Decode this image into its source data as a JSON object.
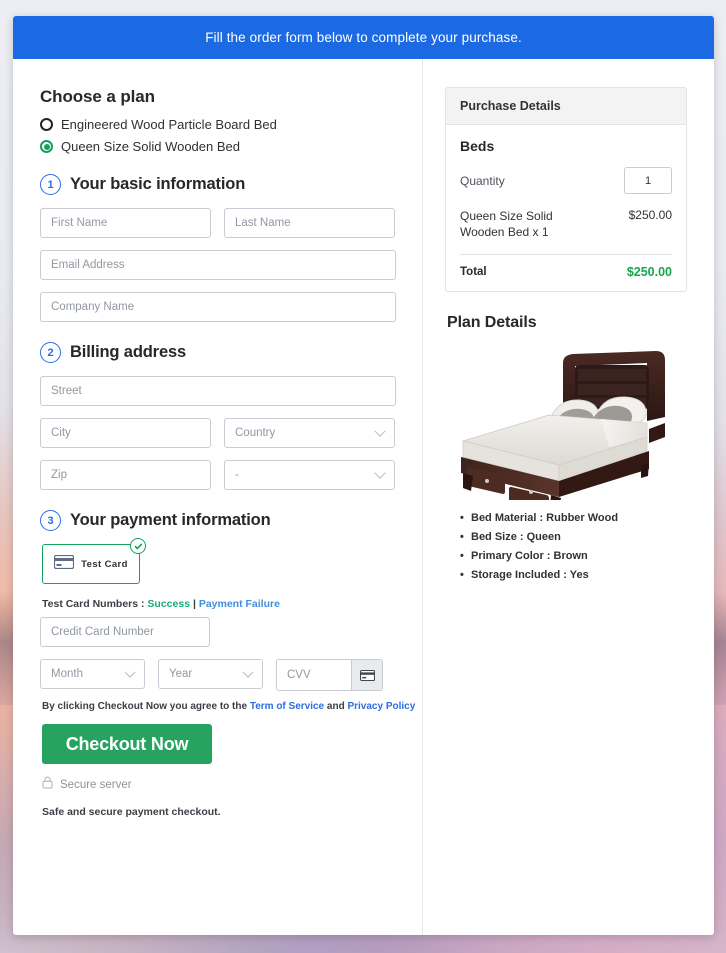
{
  "banner": {
    "text": "Fill the order form below to complete your purchase."
  },
  "plan": {
    "heading": "Choose a plan",
    "options": [
      {
        "label": "Engineered Wood Particle Board Bed",
        "selected": false
      },
      {
        "label": "Queen Size Solid Wooden Bed",
        "selected": true
      }
    ]
  },
  "step1": {
    "number": "1",
    "title": "Your basic information",
    "first_name_placeholder": "First Name",
    "last_name_placeholder": "Last Name",
    "email_placeholder": "Email Address",
    "company_placeholder": "Company Name"
  },
  "step2": {
    "number": "2",
    "title": "Billing address",
    "street_placeholder": "Street",
    "city_placeholder": "City",
    "country_placeholder": "Country",
    "zip_placeholder": "Zip",
    "state_placeholder": "-"
  },
  "step3": {
    "number": "3",
    "title": "Your payment information",
    "test_card_label": "Test  Card",
    "test_numbers_prefix": "Test Card Numbers : ",
    "test_numbers_success": "Success",
    "test_numbers_separator": " | ",
    "test_numbers_failure": "Payment Failure",
    "card_number_placeholder": "Credit Card Number",
    "month_placeholder": "Month",
    "year_placeholder": "Year",
    "cvv_placeholder": "CVV"
  },
  "footer": {
    "terms_prefix": "By clicking Checkout Now you agree to the ",
    "terms_link": "Term of Service",
    "terms_and": " and ",
    "privacy_link": "Privacy Policy",
    "checkout_label": "Checkout Now",
    "secure_server": "Secure server",
    "safe_note": "Safe and secure payment checkout."
  },
  "purchase": {
    "header": "Purchase Details",
    "category": "Beds",
    "quantity_label": "Quantity",
    "quantity_value": "1",
    "item_name": "Queen Size Solid Wooden Bed x 1",
    "item_price": "$250.00",
    "total_label": "Total",
    "total_value": "$250.00"
  },
  "plan_details": {
    "title": "Plan Details",
    "image_alt": "queen-size-solid-wooden-bed-photo",
    "specs": [
      "Bed Material : Rubber Wood",
      "Bed Size : Queen",
      "Primary Color : Brown",
      "Storage Included : Yes"
    ]
  },
  "colors": {
    "banner_blue": "#1b6ae4",
    "accent_blue": "#2a6ee0",
    "success_green": "#13a05e",
    "checkout_green": "#25a35f",
    "total_green": "#17a54f"
  }
}
